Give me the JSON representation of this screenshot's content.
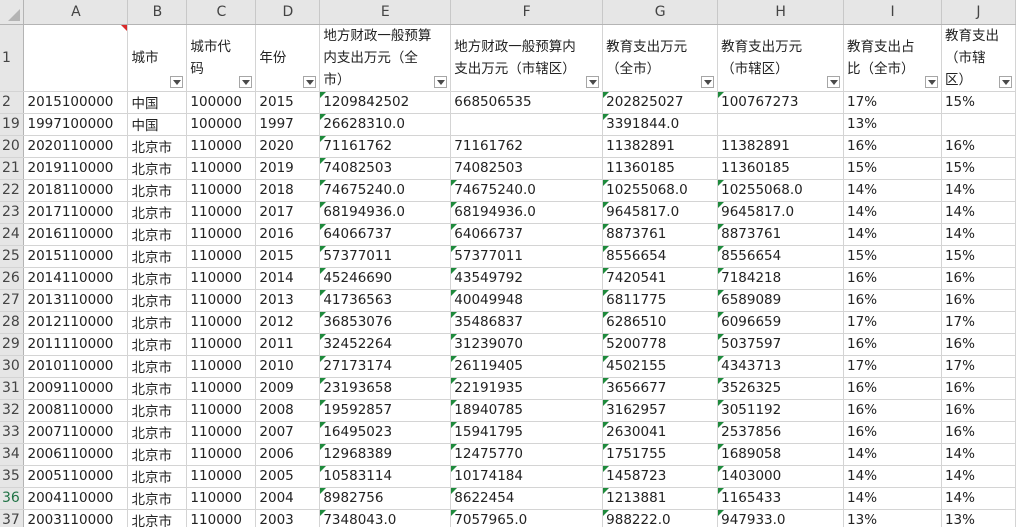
{
  "sheet": {
    "columns": [
      "A",
      "B",
      "C",
      "D",
      "E",
      "F",
      "G",
      "H",
      "I",
      "J"
    ],
    "header_row": {
      "row_number": "1",
      "cells": [
        "",
        "城市",
        "城市代码",
        "年份",
        "地方财政一般预算内支出万元（全市）",
        "地方财政一般预算内支出万元（市辖区）",
        "教育支出万元（全市）",
        "教育支出万元（市辖区）",
        "教育支出占比（全市）",
        "教育支出（市辖区）"
      ]
    },
    "rows": [
      {
        "num": "2",
        "active": false,
        "cells": [
          "2015100000",
          "中国",
          "100000",
          "2015",
          "1209842502",
          "668506535",
          "202825027",
          "100767273",
          "17%",
          "15%"
        ],
        "flags": [
          "",
          "",
          "",
          "",
          "g",
          "",
          "g",
          "g",
          "",
          ""
        ]
      },
      {
        "num": "19",
        "active": false,
        "cells": [
          "1997100000",
          "中国",
          "100000",
          "1997",
          "26628310.0",
          "",
          "3391844.0",
          "",
          "13%",
          ""
        ],
        "flags": [
          "",
          "",
          "",
          "",
          "g",
          "",
          "g",
          "",
          "",
          ""
        ]
      },
      {
        "num": "20",
        "active": false,
        "cells": [
          "2020110000",
          "北京市",
          "110000",
          "2020",
          "71161762",
          "71161762",
          "11382891",
          "11382891",
          "16%",
          "16%"
        ],
        "flags": [
          "",
          "",
          "",
          "",
          "g",
          "",
          "",
          "",
          "",
          ""
        ]
      },
      {
        "num": "21",
        "active": false,
        "cells": [
          "2019110000",
          "北京市",
          "110000",
          "2019",
          "74082503",
          "74082503",
          "11360185",
          "11360185",
          "15%",
          "15%"
        ],
        "flags": [
          "",
          "",
          "",
          "",
          "g",
          "",
          "",
          "",
          "",
          ""
        ]
      },
      {
        "num": "22",
        "active": false,
        "cells": [
          "2018110000",
          "北京市",
          "110000",
          "2018",
          "74675240.0",
          "74675240.0",
          "10255068.0",
          "10255068.0",
          "14%",
          "14%"
        ],
        "flags": [
          "",
          "",
          "",
          "",
          "g",
          "g",
          "g",
          "g",
          "",
          ""
        ]
      },
      {
        "num": "23",
        "active": false,
        "cells": [
          "2017110000",
          "北京市",
          "110000",
          "2017",
          "68194936.0",
          "68194936.0",
          "9645817.0",
          "9645817.0",
          "14%",
          "14%"
        ],
        "flags": [
          "",
          "",
          "",
          "",
          "g",
          "g",
          "g",
          "g",
          "",
          ""
        ]
      },
      {
        "num": "24",
        "active": false,
        "cells": [
          "2016110000",
          "北京市",
          "110000",
          "2016",
          "64066737",
          "64066737",
          "8873761",
          "8873761",
          "14%",
          "14%"
        ],
        "flags": [
          "",
          "",
          "",
          "",
          "g",
          "g",
          "g",
          "g",
          "",
          ""
        ]
      },
      {
        "num": "25",
        "active": false,
        "cells": [
          "2015110000",
          "北京市",
          "110000",
          "2015",
          "57377011",
          "57377011",
          "8556654",
          "8556654",
          "15%",
          "15%"
        ],
        "flags": [
          "",
          "",
          "",
          "",
          "g",
          "g",
          "g",
          "g",
          "",
          ""
        ]
      },
      {
        "num": "26",
        "active": false,
        "cells": [
          "2014110000",
          "北京市",
          "110000",
          "2014",
          "45246690",
          "43549792",
          "7420541",
          "7184218",
          "16%",
          "16%"
        ],
        "flags": [
          "",
          "",
          "",
          "",
          "g",
          "g",
          "g",
          "g",
          "",
          ""
        ]
      },
      {
        "num": "27",
        "active": false,
        "cells": [
          "2013110000",
          "北京市",
          "110000",
          "2013",
          "41736563",
          "40049948",
          "6811775",
          "6589089",
          "16%",
          "16%"
        ],
        "flags": [
          "",
          "",
          "",
          "",
          "g",
          "g",
          "g",
          "g",
          "",
          ""
        ]
      },
      {
        "num": "28",
        "active": false,
        "cells": [
          "2012110000",
          "北京市",
          "110000",
          "2012",
          "36853076",
          "35486837",
          "6286510",
          "6096659",
          "17%",
          "17%"
        ],
        "flags": [
          "",
          "",
          "",
          "",
          "g",
          "g",
          "g",
          "g",
          "",
          ""
        ]
      },
      {
        "num": "29",
        "active": false,
        "cells": [
          "2011110000",
          "北京市",
          "110000",
          "2011",
          "32452264",
          "31239070",
          "5200778",
          "5037597",
          "16%",
          "16%"
        ],
        "flags": [
          "",
          "",
          "",
          "",
          "g",
          "g",
          "g",
          "g",
          "",
          ""
        ]
      },
      {
        "num": "30",
        "active": false,
        "cells": [
          "2010110000",
          "北京市",
          "110000",
          "2010",
          "27173174",
          "26119405",
          "4502155",
          "4343713",
          "17%",
          "17%"
        ],
        "flags": [
          "",
          "",
          "",
          "",
          "g",
          "g",
          "g",
          "g",
          "",
          ""
        ]
      },
      {
        "num": "31",
        "active": false,
        "cells": [
          "2009110000",
          "北京市",
          "110000",
          "2009",
          "23193658",
          "22191935",
          "3656677",
          "3526325",
          "16%",
          "16%"
        ],
        "flags": [
          "",
          "",
          "",
          "",
          "g",
          "g",
          "g",
          "g",
          "",
          ""
        ]
      },
      {
        "num": "32",
        "active": false,
        "cells": [
          "2008110000",
          "北京市",
          "110000",
          "2008",
          "19592857",
          "18940785",
          "3162957",
          "3051192",
          "16%",
          "16%"
        ],
        "flags": [
          "",
          "",
          "",
          "",
          "g",
          "g",
          "g",
          "g",
          "",
          ""
        ]
      },
      {
        "num": "33",
        "active": false,
        "cells": [
          "2007110000",
          "北京市",
          "110000",
          "2007",
          "16495023",
          "15941795",
          "2630041",
          "2537856",
          "16%",
          "16%"
        ],
        "flags": [
          "",
          "",
          "",
          "",
          "g",
          "g",
          "g",
          "g",
          "",
          ""
        ]
      },
      {
        "num": "34",
        "active": false,
        "cells": [
          "2006110000",
          "北京市",
          "110000",
          "2006",
          "12968389",
          "12475770",
          "1751755",
          "1689058",
          "14%",
          "14%"
        ],
        "flags": [
          "",
          "",
          "",
          "",
          "g",
          "g",
          "g",
          "g",
          "",
          ""
        ]
      },
      {
        "num": "35",
        "active": false,
        "cells": [
          "2005110000",
          "北京市",
          "110000",
          "2005",
          "10583114",
          "10174184",
          "1458723",
          "1403000",
          "14%",
          "14%"
        ],
        "flags": [
          "",
          "",
          "",
          "",
          "g",
          "g",
          "g",
          "g",
          "",
          ""
        ]
      },
      {
        "num": "36",
        "active": true,
        "cells": [
          "2004110000",
          "北京市",
          "110000",
          "2004",
          "8982756",
          "8622454",
          "1213881",
          "1165433",
          "14%",
          "14%"
        ],
        "flags": [
          "",
          "",
          "",
          "",
          "g",
          "g",
          "g",
          "g",
          "",
          ""
        ]
      },
      {
        "num": "37",
        "active": false,
        "cells": [
          "2003110000",
          "北京市",
          "110000",
          "2003",
          "7348043.0",
          "7057965.0",
          "988222.0",
          "947933.0",
          "13%",
          "13%"
        ],
        "flags": [
          "",
          "",
          "",
          "",
          "g",
          "g",
          "g",
          "g",
          "",
          ""
        ]
      }
    ]
  }
}
